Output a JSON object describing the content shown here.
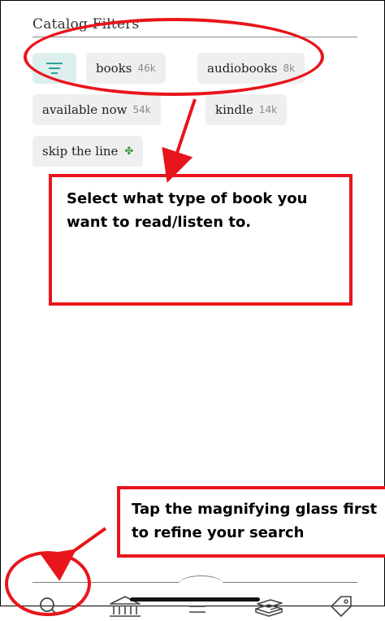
{
  "catalog": {
    "title": "Catalog Filters",
    "chips": [
      {
        "label": "books",
        "count": "46k"
      },
      {
        "label": "audiobooks",
        "count": "8k"
      },
      {
        "label": "available now",
        "count": "54k"
      },
      {
        "label": "kindle",
        "count": "14k"
      },
      {
        "label": "skip the line",
        "icon": "clover-icon"
      }
    ]
  },
  "annotations": {
    "type_callout": "Select what type of book you want to read/listen to.",
    "search_callout": "Tap the magnifying glass first to refine your search"
  },
  "tabbar": {
    "items": [
      {
        "icon": "search-icon"
      },
      {
        "icon": "library-icon"
      },
      {
        "icon": "menu-icon"
      },
      {
        "icon": "bookshelf-icon"
      },
      {
        "icon": "tag-icon"
      }
    ]
  },
  "colors": {
    "annotation_red": "#e8151c",
    "filter_teal": "#2aa198",
    "chip_bg": "#efefef",
    "clover_green": "#3b9b43"
  }
}
